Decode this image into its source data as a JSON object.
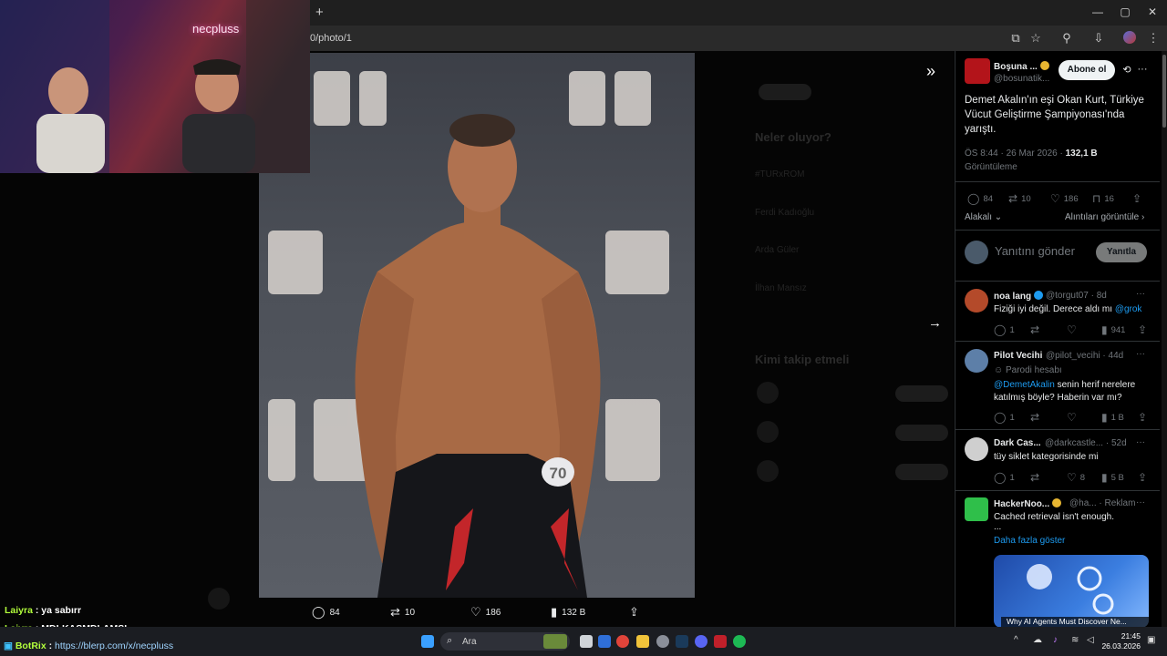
{
  "browser": {
    "new_tab_glyph": "+",
    "url_fragment": "0/photo/1",
    "window_controls": [
      "—",
      "▢",
      "✕"
    ]
  },
  "photo": {
    "bib_number": "70",
    "actions": {
      "replies": "84",
      "reposts": "10",
      "likes": "186",
      "views": "132 B"
    }
  },
  "background_trends": {
    "heading": "Neler oluyor?",
    "items": [
      "#TURxROM",
      "Ferdi Kadıoğlu",
      "Arda Güler",
      "İlhan Mansız"
    ],
    "follow_heading": "Kimi takip etmeli"
  },
  "tweet": {
    "author_name": "Boşuna ...",
    "author_handle": "@bosunatik...",
    "subscribe_label": "Abone ol",
    "text": "Demet Akalın'ın eşi Okan Kurt, Türkiye Vücut Geliştirme Şampiyonası'nda yarıştı.",
    "time": "ÖS 8:44 · 26 Mar 2026 · ",
    "views": "132,1 B",
    "views_label": "Görüntüleme",
    "stats": {
      "replies": "84",
      "reposts": "10",
      "likes": "186",
      "bookmarks": "16"
    },
    "sort_label": "Alakalı",
    "quotes_label": "Alıntıları görüntüle",
    "reply_placeholder": "Yanıtını gönder",
    "reply_button": "Yanıtla"
  },
  "replies": [
    {
      "name": "noa lang",
      "handle": "@torgut07 · 8d",
      "text": "Fiziği iyi değil. Derece aldı mı ",
      "mention": "@grok",
      "stats": {
        "replies": "1",
        "likes": "",
        "views": "941"
      }
    },
    {
      "name": "Pilot Vecihi",
      "handle": "@pilot_vecihi · 44d",
      "badge": "Parodi hesabı",
      "mention": "@DemetAkalin",
      "text": " senin herif nerelere",
      "text2": "katılmış böyle? Haberin var mı?",
      "stats": {
        "replies": "1",
        "likes": "",
        "views": "1 B"
      }
    },
    {
      "name": "Dark Cas...",
      "handle": "@darkcastle... · 52d",
      "text": "tüy siklet kategorisinde mi",
      "stats": {
        "replies": "1",
        "likes": "8",
        "views": "5 B"
      }
    },
    {
      "name": "HackerNoo...",
      "handle": "@ha... · Reklam",
      "text": "Cached retrieval isn't enough.",
      "text2": "...",
      "more": "Daha fazla göster",
      "ad_caption": "Why AI Agents Must Discover Ne..."
    }
  ],
  "stream": {
    "webcam_logo": "necpluss",
    "chat": [
      {
        "user": "Laiyra",
        "msg": "ya sabırr"
      },
      {
        "user": "Laiyra",
        "msg": "MDLKASMDLAMSL"
      },
      {
        "user": "BotRix",
        "msg": "",
        "link": "https://blerp.com/x/necpluss"
      }
    ]
  },
  "taskbar": {
    "search_placeholder": "Ara",
    "time": "21:45",
    "date": "26.03.2026"
  },
  "colors": {
    "accent": "#1d9bf0",
    "chat_user": "#b3ff3c",
    "verified_gold": "#e8b631"
  }
}
